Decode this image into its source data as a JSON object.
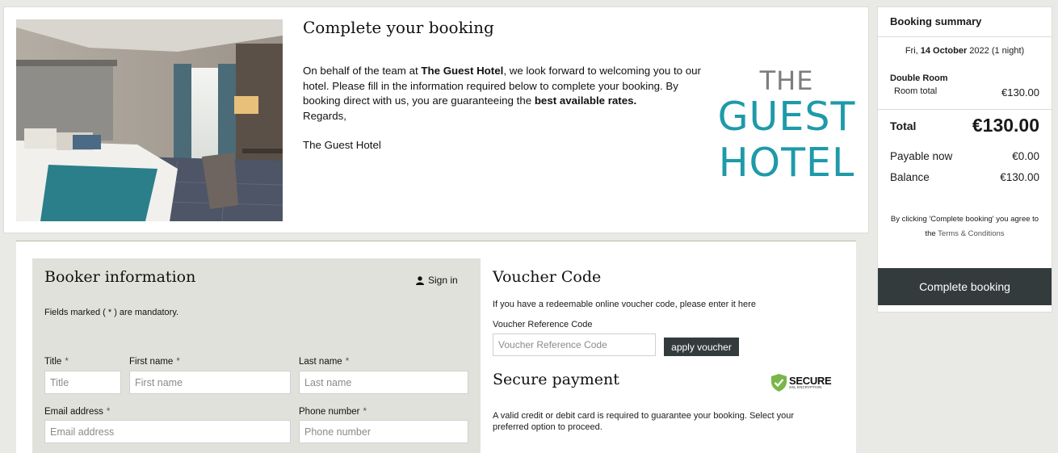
{
  "hero": {
    "title": "Complete your booking",
    "intro_pre": "On behalf of the team at ",
    "hotel_bold": "The Guest Hotel",
    "intro_mid": ", we look forward to welcoming you to our hotel. Please fill in the information required below to complete your booking. By booking direct with us, you are guaranteeing the ",
    "rates_bold": "best available rates.",
    "regards": "Regards,",
    "signature": "The Guest Hotel"
  },
  "logo": {
    "line1": "THE",
    "line2": "GUEST",
    "line3": "HOTEL"
  },
  "booker": {
    "title": "Booker information",
    "sign_in": "Sign in",
    "mandatory_note": "Fields marked ( * ) are mandatory.",
    "fields": {
      "title": {
        "label": "Title",
        "required": "*",
        "placeholder": "Title",
        "value": ""
      },
      "first_name": {
        "label": "First name",
        "required": "*",
        "placeholder": "First name",
        "value": ""
      },
      "last_name": {
        "label": "Last name",
        "required": "*",
        "placeholder": "Last name",
        "value": ""
      },
      "email": {
        "label": "Email address",
        "required": "*",
        "placeholder": "Email address",
        "value": ""
      },
      "phone": {
        "label": "Phone number",
        "required": "*",
        "placeholder": "Phone number",
        "value": ""
      }
    }
  },
  "voucher": {
    "title": "Voucher Code",
    "description": "If you have a redeemable online voucher code, please enter it here",
    "label": "Voucher Reference Code",
    "placeholder": "Voucher Reference Code",
    "value": "",
    "apply_label": "apply voucher"
  },
  "payment": {
    "title": "Secure payment",
    "badge_main": "SECURE",
    "badge_sub": "SSL ENCRYPTION",
    "description": "A valid credit or debit card is required to guarantee your booking. Select your preferred option to proceed."
  },
  "summary": {
    "title": "Booking summary",
    "date_prefix": "Fri, ",
    "date_bold": "14 October",
    "date_suffix": " 2022 (1 night)",
    "room_name": "Double Room",
    "room_total_label": "Room total",
    "room_total_value": "€130.00",
    "total_label": "Total",
    "total_value": "€130.00",
    "payable_label": "Payable now",
    "payable_value": "€0.00",
    "balance_label": "Balance",
    "balance_value": "€130.00",
    "terms_pre": "By clicking 'Complete booking' you agree to the ",
    "terms_link": "Terms & Conditions",
    "complete_label": "Complete booking"
  },
  "colors": {
    "logo_teal": "#1e9aa9",
    "logo_grey": "#7d7d7d",
    "button_dark": "#333b3d",
    "secure_green": "#7ab648"
  }
}
